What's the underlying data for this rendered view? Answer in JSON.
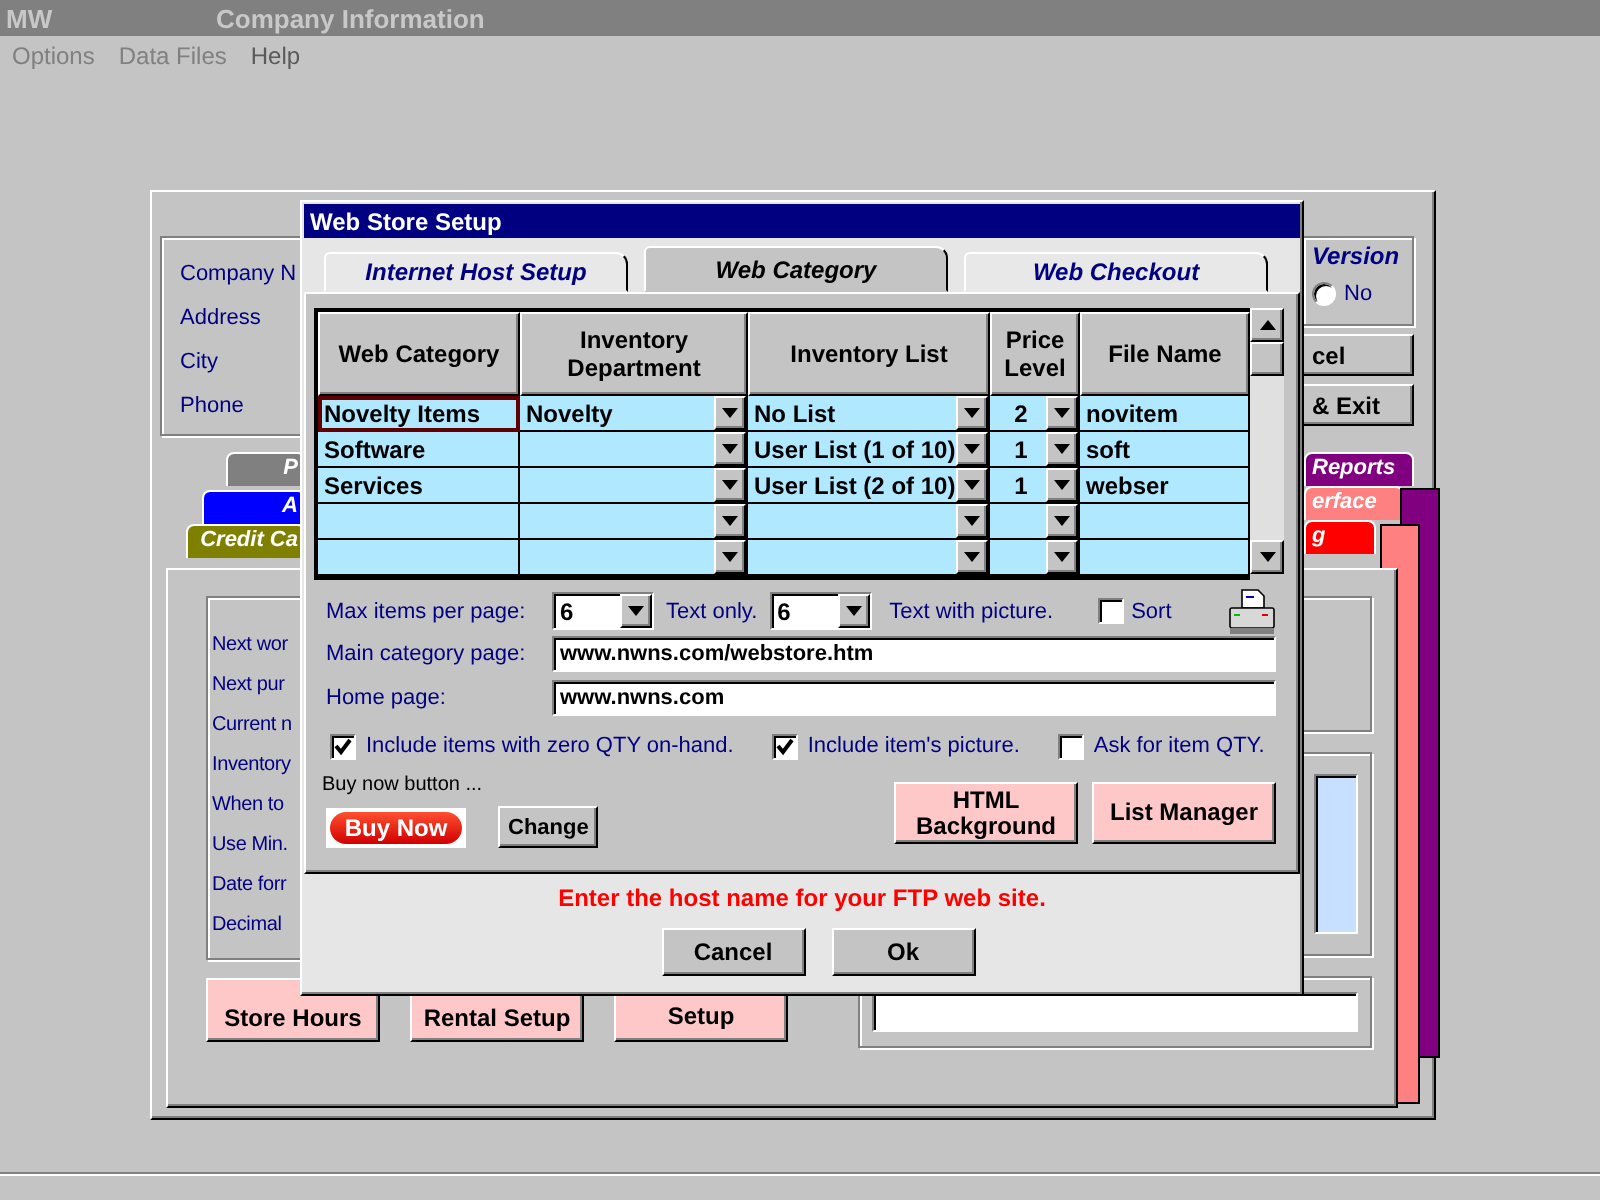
{
  "window": {
    "app_label": "MW",
    "title": "Company Information"
  },
  "menu": [
    {
      "label": "Options",
      "disabled": true
    },
    {
      "label": "Data Files",
      "disabled": true
    },
    {
      "label": "Help",
      "disabled": false
    }
  ],
  "background": {
    "company_labels": [
      "Company N",
      "Address",
      "City",
      "Phone"
    ],
    "version": {
      "label": "Version",
      "option": "No",
      "selected": false
    },
    "buttons": [
      "cel",
      "& Exit"
    ],
    "left_tabs": [
      {
        "label": "P",
        "color": "#808080"
      },
      {
        "label": "A",
        "color": "#0000ff"
      },
      {
        "label": "Credit Ca",
        "color": "#808000"
      }
    ],
    "right_tabs": [
      {
        "label": "Reports",
        "color": "#800080"
      },
      {
        "label": "erface",
        "color": "#ff8080"
      },
      {
        "label": "g",
        "color": "#ff0000"
      }
    ],
    "settings_labels": [
      "Next wor",
      "Next pur",
      "Current n",
      "Inventory",
      "When to",
      "Use Min.",
      "Date forr",
      "Decimal"
    ],
    "bottom_buttons": [
      "Store Hours",
      "Rental Setup",
      "Setup"
    ]
  },
  "dialog": {
    "title": "Web Store Setup",
    "tabs": [
      {
        "label": "Internet Host Setup",
        "selected": false
      },
      {
        "label": "Web Category",
        "selected": true
      },
      {
        "label": "Web Checkout",
        "selected": false
      }
    ],
    "grid": {
      "columns": [
        "Web Category",
        "Inventory Department",
        "Inventory List",
        "Price Level",
        "File Name"
      ],
      "rows": [
        {
          "web_category": "Novelty Items",
          "department": "Novelty",
          "list": "No List",
          "price_level": "2",
          "file_name": "novitem",
          "focused": true
        },
        {
          "web_category": "Software",
          "list": "User List (1 of 10)",
          "price_level": "1",
          "file_name": "soft",
          "focused": false
        },
        {
          "web_category": "Services",
          "list": "User List (2 of 10)",
          "price_level": "1",
          "file_name": "webser",
          "focused": false
        },
        {
          "focused": false
        },
        {
          "focused": false
        }
      ]
    },
    "max_items": {
      "label": "Max items per page:",
      "value": "6"
    },
    "text_only": {
      "label": "Text only.",
      "value": "6"
    },
    "text_with_picture": {
      "label": "Text with picture."
    },
    "sort": {
      "label": "Sort",
      "checked": false
    },
    "main_category": {
      "label": "Main category page:",
      "value": "www.nwns.com/webstore.htm"
    },
    "home_page": {
      "label": "Home page:",
      "value": "www.nwns.com"
    },
    "options": [
      {
        "label": "Include items with zero QTY on-hand.",
        "checked": true
      },
      {
        "label": "Include item's picture.",
        "checked": true
      },
      {
        "label": "Ask for item QTY.",
        "checked": false
      }
    ],
    "buy_now_caption": "Buy now button ...",
    "buy_now_image": "Buy Now",
    "change_button": "Change",
    "side_buttons": [
      "HTML Background",
      "List Manager"
    ],
    "message": "Enter the host name for your FTP web site.",
    "buttons": [
      "Cancel",
      "Ok"
    ]
  }
}
